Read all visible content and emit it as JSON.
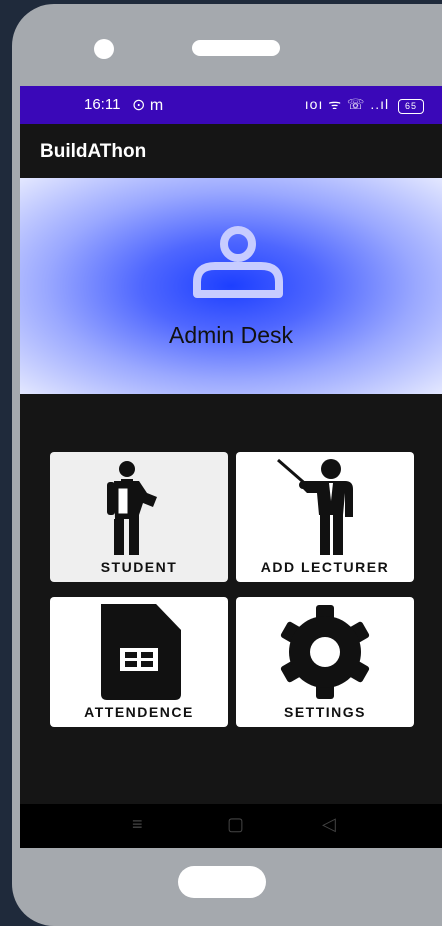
{
  "status_bar": {
    "time": "16:11",
    "left_icons": "⊙ m",
    "signal_icons": "ıoı ᯤ ☏ ..ıl",
    "battery_level": "65"
  },
  "app_bar": {
    "title": "BuildAThon"
  },
  "hero": {
    "title": "Admin Desk",
    "gradient_center": "#1d3fff",
    "gradient_edge": "#e4e8ff"
  },
  "tiles": [
    {
      "label": "STUDENT",
      "icon": "student-icon"
    },
    {
      "label": "ADD LECTURER",
      "icon": "lecturer-icon"
    },
    {
      "label": "ATTENDENCE",
      "icon": "document-table-icon"
    },
    {
      "label": "SETTINGS",
      "icon": "gear-icon"
    }
  ],
  "navbar": {
    "menu_icon": "≡",
    "home_icon": "▢",
    "back_icon": "◁"
  },
  "colors": {
    "status_bar": "#3a08b8",
    "screen_bg": "#151515",
    "frame": "#a5a9ae",
    "page_bg": "#1f2a3b"
  }
}
